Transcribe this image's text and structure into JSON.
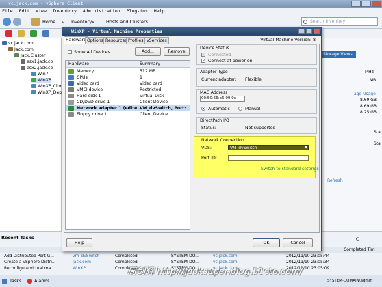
{
  "window": {
    "title": "vc.jack.com - vSphere Client"
  },
  "menu": [
    "File",
    "Edit",
    "View",
    "Inventory",
    "Administration",
    "Plug-ins",
    "Help"
  ],
  "nav": {
    "home": "Home",
    "inventory": "Inventory",
    "hosts_clusters": "Hosts and Clusters",
    "search_placeholder": "Search Inventory"
  },
  "tree": [
    {
      "label": "vc.jack.com",
      "level": 0
    },
    {
      "label": "Jack.com",
      "level": 1
    },
    {
      "label": "Jack.Cluster",
      "level": 2
    },
    {
      "label": "esx1.jack.co",
      "level": 3
    },
    {
      "label": "esx2.jack.co",
      "level": 3
    },
    {
      "label": "Win7",
      "level": 3
    },
    {
      "label": "WinXP",
      "level": 3
    },
    {
      "label": "WinXP_Clor",
      "level": 3
    },
    {
      "label": "WinXP_Dep",
      "level": 3
    }
  ],
  "right_panel": {
    "tab": "Storage Views",
    "values": [
      "MHz",
      "MB",
      "age Usage",
      "8.69 GB",
      "8.69 GB",
      "8.25 GB",
      "Sta",
      "Sta",
      "Refresh"
    ]
  },
  "tasks": {
    "title": "Recent Tasks",
    "completed_time_header": "Completed Tim",
    "rows": [
      {
        "name": "Add Distributed Port G...",
        "target": "vm_dvSwitch",
        "status": "Completed",
        "initiator": "SYSTEM-DO...",
        "vc": "vc.jack.com",
        "time": "2012/11/10 23:05:44"
      },
      {
        "name": "Create a vSphere Distri...",
        "target": "Jack.com",
        "status": "Completed",
        "initiator": "SYSTEM-DO...",
        "vc": "vc.jack.com",
        "time": "2012/11/10 23:05:34"
      },
      {
        "name": "Reconfigure virtual ma...",
        "target": "WinXP",
        "status": "Completed",
        "initiator": "SYSTEM-DO...",
        "vc": "vc.jack.com",
        "time": "2012/11/10 23:05:09"
      }
    ],
    "clear_label": "C"
  },
  "statusbar": {
    "tasks": "Tasks",
    "alarms": "Alarms",
    "user": "SYSTEM-DOMAIN\\admin"
  },
  "dialog": {
    "title": "WinXP - Virtual Machine Properties",
    "tabs": [
      "Hardware",
      "Options",
      "Resources",
      "Profiles",
      "vServices"
    ],
    "vm_version": "Virtual Machine Version: 8",
    "show_all_devices": "Show All Devices",
    "add_button": "Add...",
    "remove_button": "Remove",
    "hw_headers": [
      "Hardware",
      "Summary"
    ],
    "hardware": [
      {
        "name": "Memory",
        "summary": "512 MB",
        "icon_color": "#6a9a3a"
      },
      {
        "name": "CPUs",
        "summary": "1",
        "icon_color": "#4a7ab8"
      },
      {
        "name": "Video card",
        "summary": "Video card",
        "icon_color": "#3a6aa8"
      },
      {
        "name": "VMCI device",
        "summary": "Restricted",
        "icon_color": "#7a7a7a"
      },
      {
        "name": "Hard disk 1",
        "summary": "Virtual Disk",
        "icon_color": "#8a8a8a"
      },
      {
        "name": "CD/DVD drive 1",
        "summary": "Client Device",
        "icon_color": "#9a9a9a"
      },
      {
        "name": "Network adapter 1 (edite...",
        "summary": "VM_dvSwitch, Port:",
        "icon_color": "#2a8a3a"
      },
      {
        "name": "Floppy drive 1",
        "summary": "Client Device",
        "icon_color": "#8a8a8a"
      }
    ],
    "device_status": {
      "title": "Device Status",
      "connected": "Connected",
      "connect_power_on": "Connect at power on"
    },
    "adapter_type": {
      "title": "Adapter Type",
      "label": "Current adapter:",
      "value": "Flexible"
    },
    "mac": {
      "title": "MAC Address",
      "value": "00:50:56:b6:09:9e",
      "automatic": "Automatic",
      "manual": "Manual"
    },
    "directpath": {
      "title": "DirectPath I/O",
      "label": "Status:",
      "value": "Not supported"
    },
    "network": {
      "title": "Network Connection",
      "vds_label": "VDS:",
      "vds_value": "VM_dvSwitch",
      "port_label": "Port ID:",
      "switch_link": "Switch to standard settings"
    },
    "help_button": "Help",
    "ok_button": "OK",
    "cancel_button": "Cancel"
  },
  "watermark": "周剑辉 http://jacksuper.blog.51cto.com/"
}
